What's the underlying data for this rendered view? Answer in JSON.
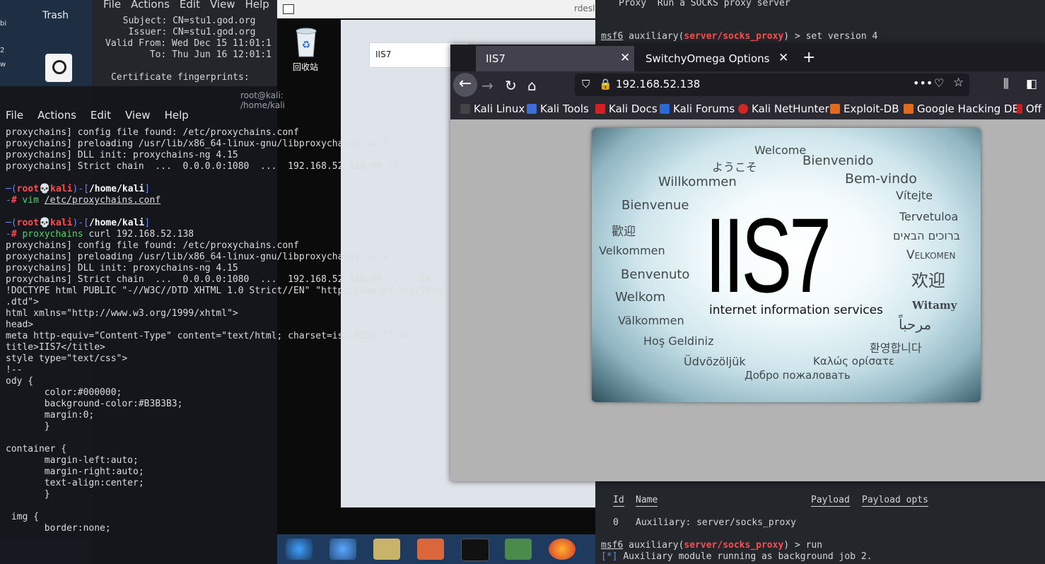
{
  "desktop": {
    "trash_label": "Trash",
    "edge_chars": [
      "bi",
      "2",
      "w"
    ]
  },
  "cert_window": {
    "menu": [
      "File",
      "Actions",
      "Edit",
      "View",
      "Help"
    ],
    "lines": [
      "  Subject: CN=stu1.god.org",
      "   Issuer: CN=stu1.god.org",
      "Valid From: Wed Dec 15 11:01:1",
      "       To: Thu Jun 16 12:01:1",
      "",
      "Certificate fingerprints:"
    ]
  },
  "rdesktop": {
    "title": "rdesl",
    "recycle_label": "回收站",
    "ie_tab": "IIS7"
  },
  "terminal": {
    "title": "root@kali: /home/kali",
    "menu": [
      "File",
      "Actions",
      "Edit",
      "View",
      "Help"
    ]
  },
  "msf": {
    "top_line": "Proxy  Run a SOCKS proxy server",
    "prompt": "msf6",
    "module": "server/socks_proxy",
    "cmd1": "set version 4",
    "table_headers": [
      "Id",
      "Name",
      "Payload",
      "Payload opts"
    ],
    "table_row": [
      "0",
      "Auxiliary: server/socks_proxy"
    ],
    "cmd2": "run",
    "status": "Auxiliary module running as background job 2."
  },
  "firefox": {
    "tabs": [
      "IIS7",
      "SwitchyOmega Options"
    ],
    "url": "192.168.52.138",
    "bookmarks": [
      "Kali Linux",
      "Kali Tools",
      "Kali Docs",
      "Kali Forums",
      "Kali NetHunter",
      "Exploit-DB",
      "Google Hacking DB",
      "Off"
    ],
    "iis": {
      "logo": "IIS7",
      "subtitle": "internet information services",
      "words": [
        "Welcome",
        "ようこそ",
        "Bienvenido",
        "Willkommen",
        "Bem-vindo",
        "Vítejte",
        "Bienvenue",
        "Tervetuloa",
        "歡迎",
        "ברוכים הבאים",
        "Velkommen",
        "Velkomen",
        "欢迎",
        "Benvenuto",
        "Welkom",
        "Witamy",
        "Välkommen",
        "مرحباً",
        "Hoş Geldiniz",
        "환영합니다",
        "Üdvözöljük",
        "Καλώς ορίσατε",
        "Добро пожаловать"
      ]
    }
  },
  "colors": {
    "kali_prompt": "#ff4c4c",
    "kali_path": "#5b8cff",
    "firefox_bg": "#1c1b22"
  }
}
